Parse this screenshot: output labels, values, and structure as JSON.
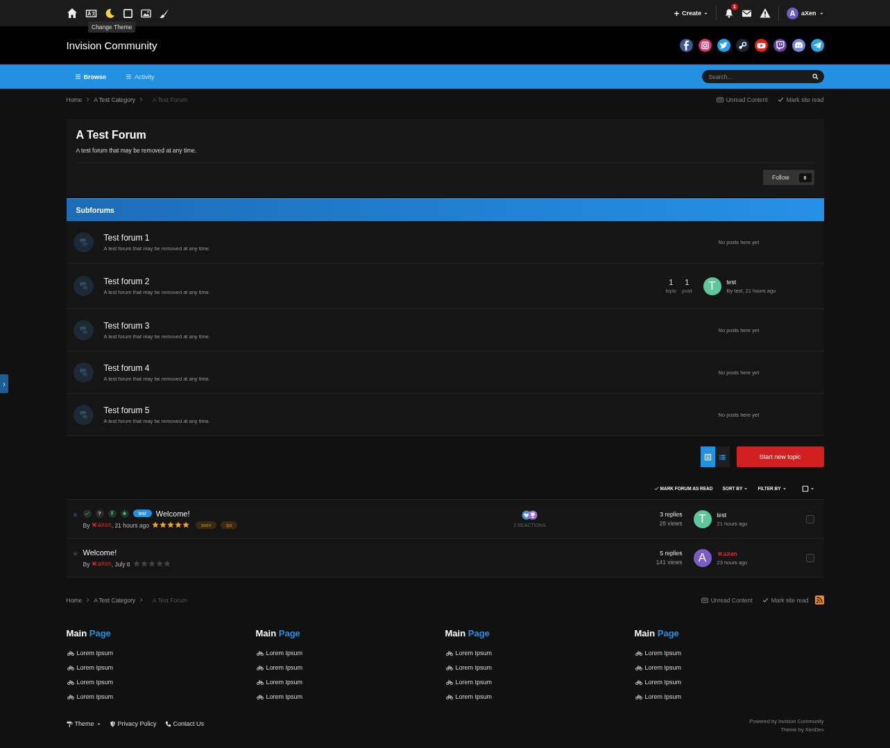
{
  "topbar": {
    "tooltip": "Change Theme",
    "create": "Create",
    "notification_count": "1",
    "user": {
      "initial": "A",
      "name": "aXen"
    }
  },
  "header": {
    "site_title": "Invision Community"
  },
  "nav": {
    "tabs": [
      {
        "label": "Browse",
        "selected": true
      },
      {
        "label": "Activity",
        "selected": false
      }
    ],
    "search": {
      "placeholder": "Search..."
    }
  },
  "breadcrumb": [
    "Home",
    "A Test Category",
    "A Test Forum"
  ],
  "actions": [
    "Unread Content",
    "Mark site read"
  ],
  "forum": {
    "title": "A Test Forum",
    "description": "A test forum that may be removed at any time.",
    "follow": "Follow",
    "follow_count": "0"
  },
  "subforums": {
    "title": "Subforums",
    "rows": [
      {
        "kind": "empty",
        "name": "Test forum 1",
        "description": "A test forum that may be removed at any time.",
        "status": "No posts here yet"
      },
      {
        "kind": "posts",
        "name": "Test forum 2",
        "description": "A test forum that may be removed at any time.",
        "topics": "1",
        "topics_label": "topic",
        "posts": "1",
        "posts_label": "post",
        "avatar": {
          "initial": "T",
          "color": "#5cc79a"
        },
        "last_title": "test",
        "last_meta": "By test, 21 hours ago"
      },
      {
        "kind": "empty",
        "name": "Test forum 3",
        "description": "A test forum that may be removed at any time.",
        "status": "No posts here yet"
      },
      {
        "kind": "empty",
        "name": "Test forum 4",
        "description": "A test forum that may be removed at any time.",
        "status": "No posts here yet"
      },
      {
        "kind": "empty",
        "name": "Test forum 5",
        "description": "A test forum that may be removed at any time.",
        "status": "No posts here yet"
      }
    ]
  },
  "view_modes": [
    {
      "selected": true
    },
    {
      "selected": false
    }
  ],
  "start_topic": "Start new topic",
  "toolbar": {
    "mark_read": "MARK FORUM AS READ",
    "sort": "SORT BY",
    "filter": "FILTER BY"
  },
  "topics": [
    {
      "badges": [
        {
          "kind": "check"
        },
        {
          "kind": "text",
          "text": "?"
        },
        {
          "kind": "pin"
        },
        {
          "kind": "star"
        }
      ],
      "prefix": "test",
      "title": "Welcome!",
      "by": "By",
      "author": "aXen",
      "date": ", 21 hours ago",
      "stars": 5,
      "tags": [
        "axen",
        "ips"
      ],
      "reactions": "2 REACTIONS",
      "replies": "3 replies",
      "views": "28 views",
      "avatar": {
        "initial": "T",
        "color": "#5cc79a"
      },
      "last_user": "test",
      "last_user_highlight": false,
      "last_date": "21 hours ago",
      "checked": false
    },
    {
      "title": "Welcome!",
      "by": "By",
      "author": "aXen",
      "date": ", July 8",
      "stars": 0,
      "replies": "5 replies",
      "views": "141 views",
      "avatar": {
        "initial": "A",
        "color": "#7a5cc7"
      },
      "last_user": "aXen",
      "last_user_highlight": true,
      "last_date": "23 hours ago",
      "checked": false
    }
  ],
  "bottom_breadcrumb": [
    "Home",
    "A Test Category",
    "A Test Forum"
  ],
  "bottom_actions": [
    "Unread Content",
    "Mark site read"
  ],
  "footer": {
    "columns": [
      {
        "title": "Main",
        "title_accent": "Page",
        "links": [
          "Lorem Ipsum",
          "Lorem Ipsum",
          "Lorem Ipsum",
          "Lorem Ipsum"
        ]
      },
      {
        "title": "Main",
        "title_accent": "Page",
        "links": [
          "Lorem Ipsum",
          "Lorem Ipsum",
          "Lorem Ipsum",
          "Lorem Ipsum"
        ]
      },
      {
        "title": "Main",
        "title_accent": "Page",
        "links": [
          "Lorem Ipsum",
          "Lorem Ipsum",
          "Lorem Ipsum",
          "Lorem Ipsum"
        ]
      },
      {
        "title": "Main",
        "title_accent": "Page",
        "links": [
          "Lorem Ipsum",
          "Lorem Ipsum",
          "Lorem Ipsum",
          "Lorem Ipsum"
        ]
      }
    ],
    "links": [
      "Theme",
      "Privacy Policy",
      "Contact Us"
    ],
    "credits": [
      "Powered by Invision Community",
      "Theme by XenDev"
    ]
  },
  "side_toggle": "›"
}
